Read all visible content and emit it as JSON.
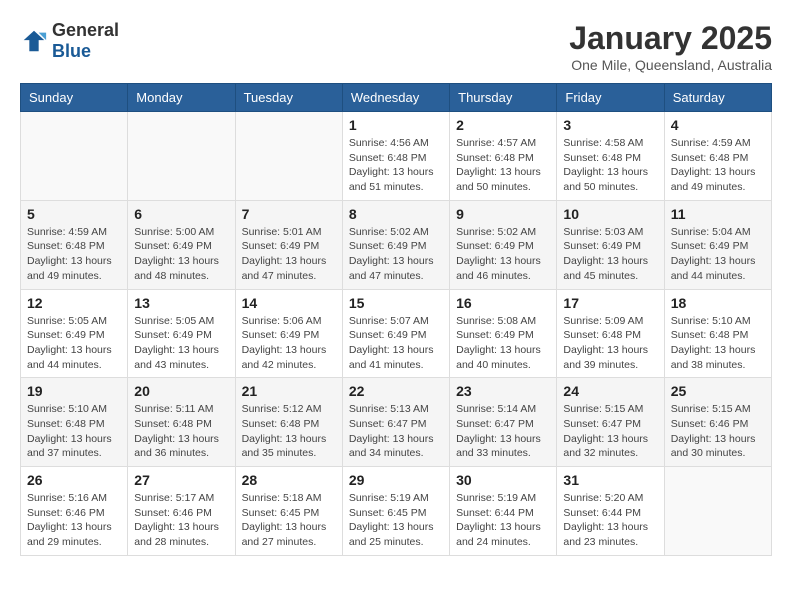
{
  "logo": {
    "general": "General",
    "blue": "Blue"
  },
  "title": "January 2025",
  "location": "One Mile, Queensland, Australia",
  "days_of_week": [
    "Sunday",
    "Monday",
    "Tuesday",
    "Wednesday",
    "Thursday",
    "Friday",
    "Saturday"
  ],
  "weeks": [
    [
      {
        "day": "",
        "info": ""
      },
      {
        "day": "",
        "info": ""
      },
      {
        "day": "",
        "info": ""
      },
      {
        "day": "1",
        "info": "Sunrise: 4:56 AM\nSunset: 6:48 PM\nDaylight: 13 hours and 51 minutes."
      },
      {
        "day": "2",
        "info": "Sunrise: 4:57 AM\nSunset: 6:48 PM\nDaylight: 13 hours and 50 minutes."
      },
      {
        "day": "3",
        "info": "Sunrise: 4:58 AM\nSunset: 6:48 PM\nDaylight: 13 hours and 50 minutes."
      },
      {
        "day": "4",
        "info": "Sunrise: 4:59 AM\nSunset: 6:48 PM\nDaylight: 13 hours and 49 minutes."
      }
    ],
    [
      {
        "day": "5",
        "info": "Sunrise: 4:59 AM\nSunset: 6:48 PM\nDaylight: 13 hours and 49 minutes."
      },
      {
        "day": "6",
        "info": "Sunrise: 5:00 AM\nSunset: 6:49 PM\nDaylight: 13 hours and 48 minutes."
      },
      {
        "day": "7",
        "info": "Sunrise: 5:01 AM\nSunset: 6:49 PM\nDaylight: 13 hours and 47 minutes."
      },
      {
        "day": "8",
        "info": "Sunrise: 5:02 AM\nSunset: 6:49 PM\nDaylight: 13 hours and 47 minutes."
      },
      {
        "day": "9",
        "info": "Sunrise: 5:02 AM\nSunset: 6:49 PM\nDaylight: 13 hours and 46 minutes."
      },
      {
        "day": "10",
        "info": "Sunrise: 5:03 AM\nSunset: 6:49 PM\nDaylight: 13 hours and 45 minutes."
      },
      {
        "day": "11",
        "info": "Sunrise: 5:04 AM\nSunset: 6:49 PM\nDaylight: 13 hours and 44 minutes."
      }
    ],
    [
      {
        "day": "12",
        "info": "Sunrise: 5:05 AM\nSunset: 6:49 PM\nDaylight: 13 hours and 44 minutes."
      },
      {
        "day": "13",
        "info": "Sunrise: 5:05 AM\nSunset: 6:49 PM\nDaylight: 13 hours and 43 minutes."
      },
      {
        "day": "14",
        "info": "Sunrise: 5:06 AM\nSunset: 6:49 PM\nDaylight: 13 hours and 42 minutes."
      },
      {
        "day": "15",
        "info": "Sunrise: 5:07 AM\nSunset: 6:49 PM\nDaylight: 13 hours and 41 minutes."
      },
      {
        "day": "16",
        "info": "Sunrise: 5:08 AM\nSunset: 6:49 PM\nDaylight: 13 hours and 40 minutes."
      },
      {
        "day": "17",
        "info": "Sunrise: 5:09 AM\nSunset: 6:48 PM\nDaylight: 13 hours and 39 minutes."
      },
      {
        "day": "18",
        "info": "Sunrise: 5:10 AM\nSunset: 6:48 PM\nDaylight: 13 hours and 38 minutes."
      }
    ],
    [
      {
        "day": "19",
        "info": "Sunrise: 5:10 AM\nSunset: 6:48 PM\nDaylight: 13 hours and 37 minutes."
      },
      {
        "day": "20",
        "info": "Sunrise: 5:11 AM\nSunset: 6:48 PM\nDaylight: 13 hours and 36 minutes."
      },
      {
        "day": "21",
        "info": "Sunrise: 5:12 AM\nSunset: 6:48 PM\nDaylight: 13 hours and 35 minutes."
      },
      {
        "day": "22",
        "info": "Sunrise: 5:13 AM\nSunset: 6:47 PM\nDaylight: 13 hours and 34 minutes."
      },
      {
        "day": "23",
        "info": "Sunrise: 5:14 AM\nSunset: 6:47 PM\nDaylight: 13 hours and 33 minutes."
      },
      {
        "day": "24",
        "info": "Sunrise: 5:15 AM\nSunset: 6:47 PM\nDaylight: 13 hours and 32 minutes."
      },
      {
        "day": "25",
        "info": "Sunrise: 5:15 AM\nSunset: 6:46 PM\nDaylight: 13 hours and 30 minutes."
      }
    ],
    [
      {
        "day": "26",
        "info": "Sunrise: 5:16 AM\nSunset: 6:46 PM\nDaylight: 13 hours and 29 minutes."
      },
      {
        "day": "27",
        "info": "Sunrise: 5:17 AM\nSunset: 6:46 PM\nDaylight: 13 hours and 28 minutes."
      },
      {
        "day": "28",
        "info": "Sunrise: 5:18 AM\nSunset: 6:45 PM\nDaylight: 13 hours and 27 minutes."
      },
      {
        "day": "29",
        "info": "Sunrise: 5:19 AM\nSunset: 6:45 PM\nDaylight: 13 hours and 25 minutes."
      },
      {
        "day": "30",
        "info": "Sunrise: 5:19 AM\nSunset: 6:44 PM\nDaylight: 13 hours and 24 minutes."
      },
      {
        "day": "31",
        "info": "Sunrise: 5:20 AM\nSunset: 6:44 PM\nDaylight: 13 hours and 23 minutes."
      },
      {
        "day": "",
        "info": ""
      }
    ]
  ]
}
